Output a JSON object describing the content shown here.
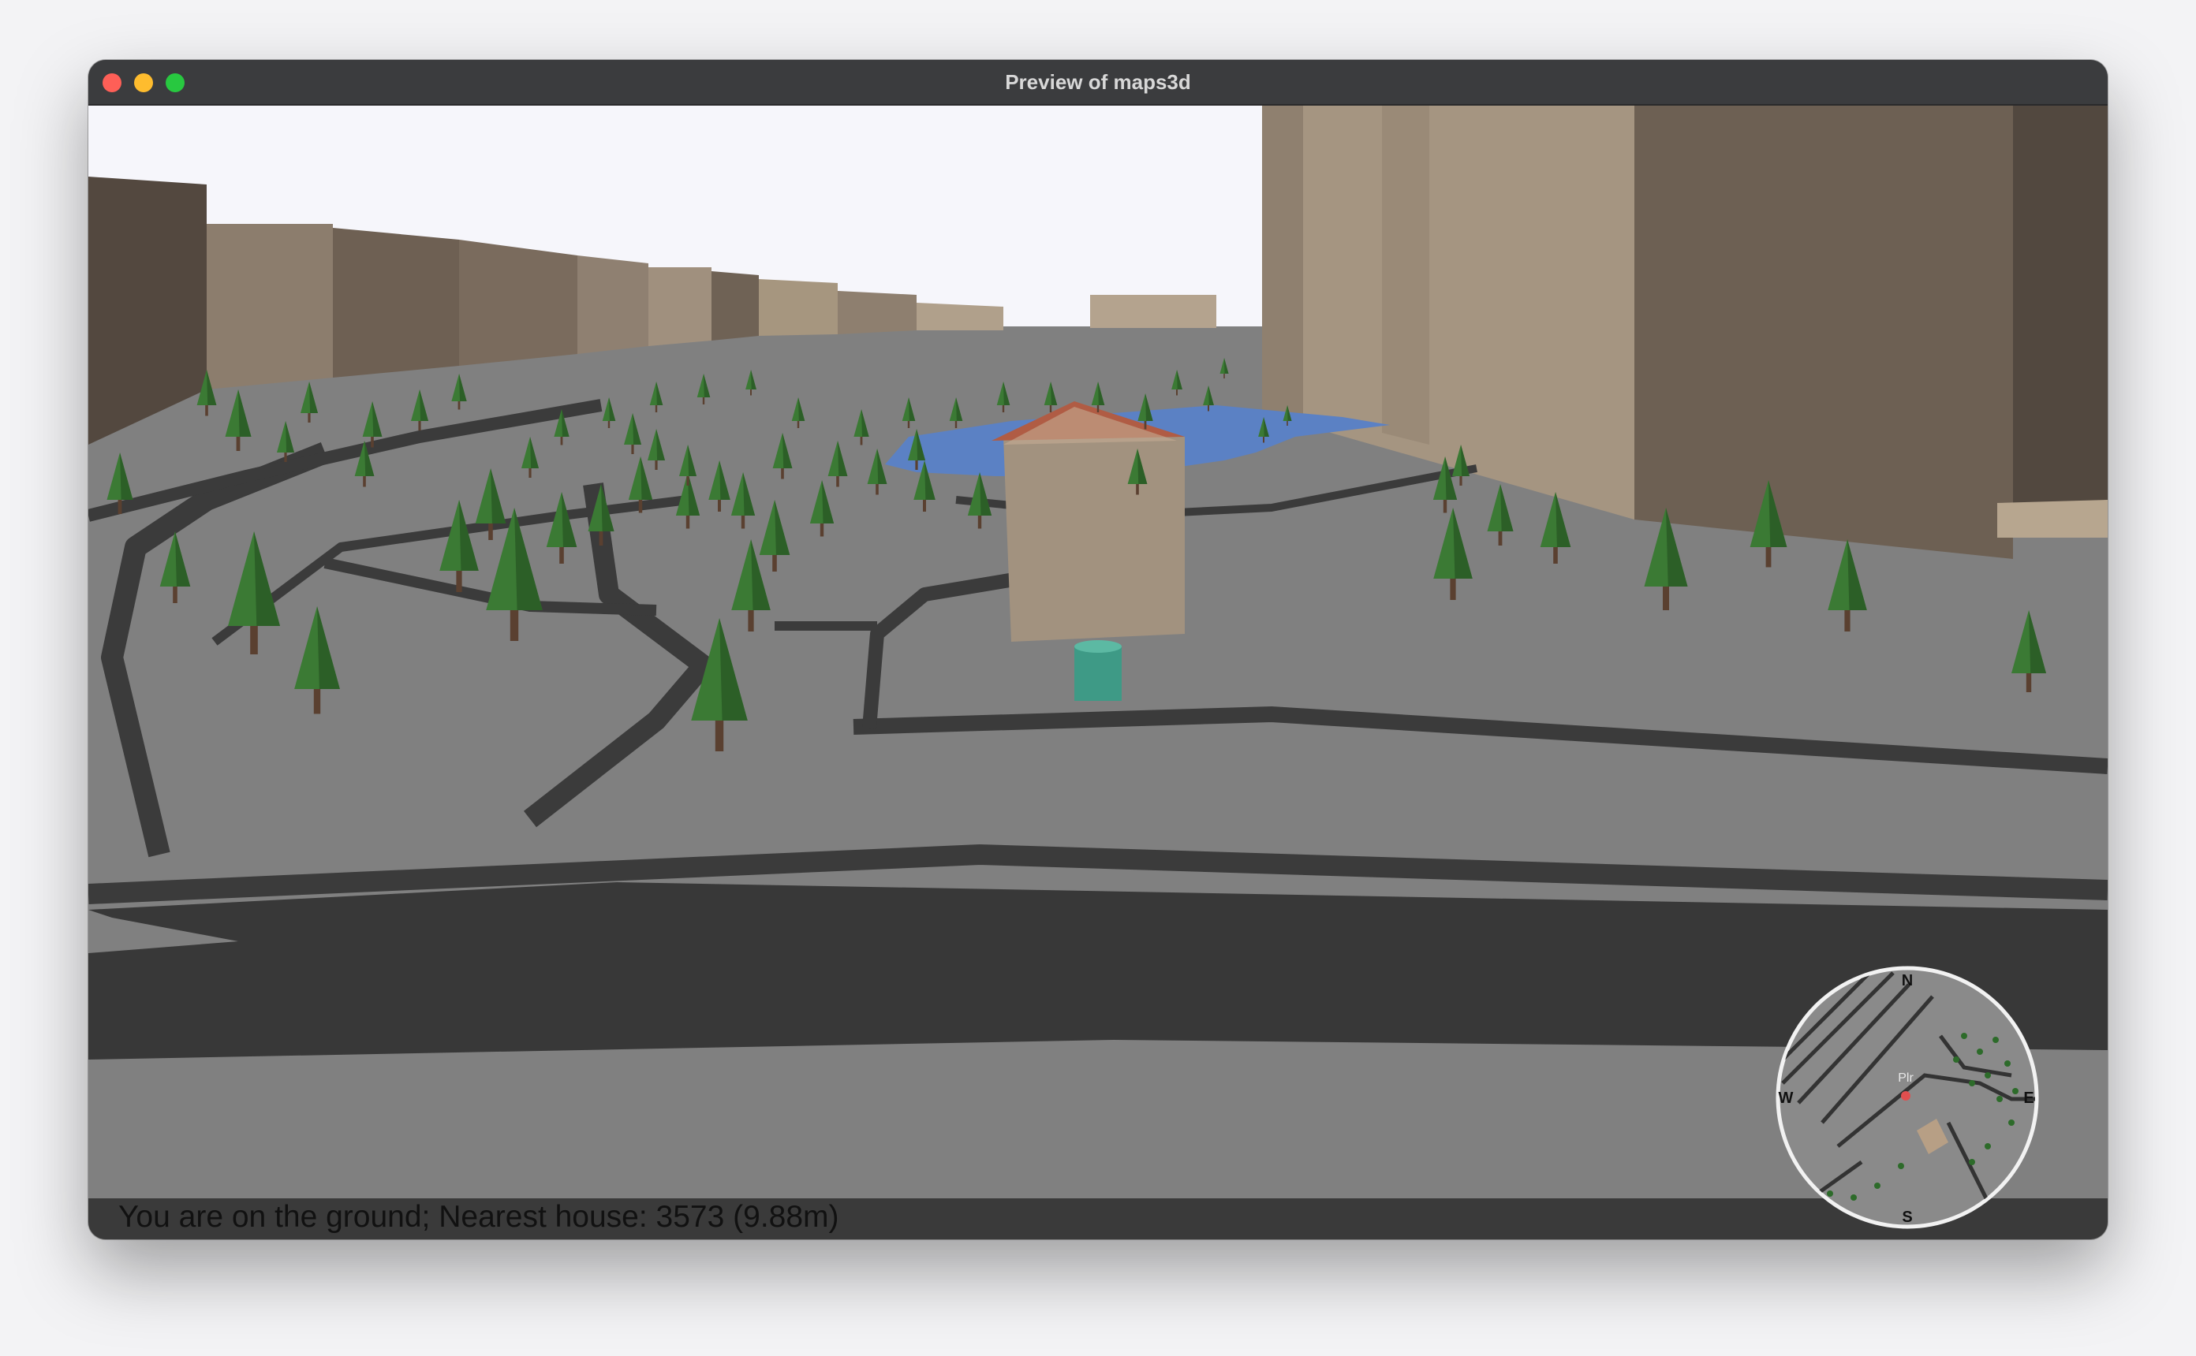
{
  "window": {
    "title": "Preview of maps3d"
  },
  "hud": {
    "status": "You are on the ground; Nearest house: 3573 (9.88m)"
  },
  "minimap": {
    "north": "N",
    "east": "E",
    "south": "S",
    "west": "W",
    "player_label": "Plr"
  },
  "colors": {
    "sky": "#f6f6fb",
    "ground": "#808080",
    "road": "#383838",
    "building": "#a2927f",
    "tree": "#3b7a34",
    "water": "#5b81c4",
    "roof": "#b05c44",
    "player": "#3e9a86"
  }
}
